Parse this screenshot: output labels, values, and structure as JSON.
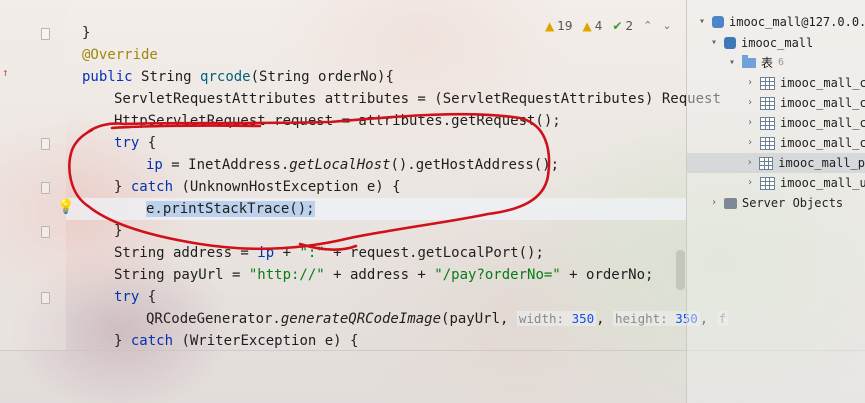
{
  "editor": {
    "lines": [
      {
        "t": "}"
      },
      {
        "ann": "@Override"
      },
      {
        "t": "public String qrcode(String orderNo){"
      },
      {
        "t": "ServletRequestAttributes attributes = (ServletRequestAttributes) Request"
      },
      {
        "t": "HttpServletRequest request = attributes.getRequest();"
      },
      {
        "t": "try {"
      },
      {
        "t": "ip = InetAddress.getLocalHost().getHostAddress();"
      },
      {
        "t": "} catch (UnknownHostException e) {"
      },
      {
        "t": "e.printStackTrace();"
      },
      {
        "t": "}"
      },
      {
        "t": "String address = ip + \":\" + request.getLocalPort();"
      },
      {
        "t": "String payUrl = \"http://\" + address + \"/pay?orderNo=\" + orderNo;"
      },
      {
        "t": "try {"
      },
      {
        "t": "QRCodeGenerator.generateQRCodeImage(payUrl, width: 350, height: 350, f"
      },
      {
        "t": "} catch (WriterException e) {"
      }
    ],
    "parts": {
      "close_brace": "}",
      "override": "@Override",
      "public": "public",
      "string": "String",
      "qrcode": "qrcode",
      "qrcode_args": "(String orderNo){",
      "l4": "ServletRequestAttributes attributes = (ServletRequestAttributes) Request",
      "l5": "HttpServletRequest request = attributes.getRequest();",
      "try": "try",
      "open_brace": " {",
      "ip_assign": "ip",
      "ip_mid": " = InetAddress.",
      "getLocalHost": "getLocalHost",
      "ip_tail": "().getHostAddress();",
      "catch_open": "} ",
      "catch": "catch",
      "catch_args": " (UnknownHostException e) {",
      "print": "e.printStackTrace();",
      "addr_a": "String address = ",
      "addr_ip": "ip",
      "addr_b": " + ",
      "addr_colon": "\":\"",
      "addr_c": " + request.getLocalPort();",
      "pay_a": "String payUrl = ",
      "pay_http": "\"http://\"",
      "pay_b": " + address + ",
      "pay_path": "\"/pay?orderNo=\"",
      "pay_c": " + orderNo;",
      "qr_a": "QRCodeGenerator.",
      "qr_fn": "generateQRCodeImage",
      "qr_b": "(payUrl, ",
      "hint_w": "width:",
      "hint_w_val": "350",
      "hint_h": "height:",
      "hint_h_val": "350",
      "qr_c": "f",
      "catch2_args": " (WriterException e) {"
    }
  },
  "inspections": {
    "warnings": "19",
    "weak_warnings": "4",
    "typos": "2"
  },
  "database_tree": {
    "connection": "imooc_mall@127.0.0.",
    "schema": "imooc_mall",
    "tables_folder": "表",
    "tables_count": "6",
    "tables": [
      "imooc_mall_c",
      "imooc_mall_c",
      "imooc_mall_c",
      "imooc_mall_c",
      "imooc_mall_p",
      "imooc_mall_u"
    ],
    "server_objects": "Server Objects"
  },
  "colors": {
    "keyword": "#0033b3",
    "string": "#067d17",
    "annotation": "#9e880d",
    "method": "#00627a",
    "selection": "#bcd2ec",
    "markup_stroke": "#d0101a"
  }
}
